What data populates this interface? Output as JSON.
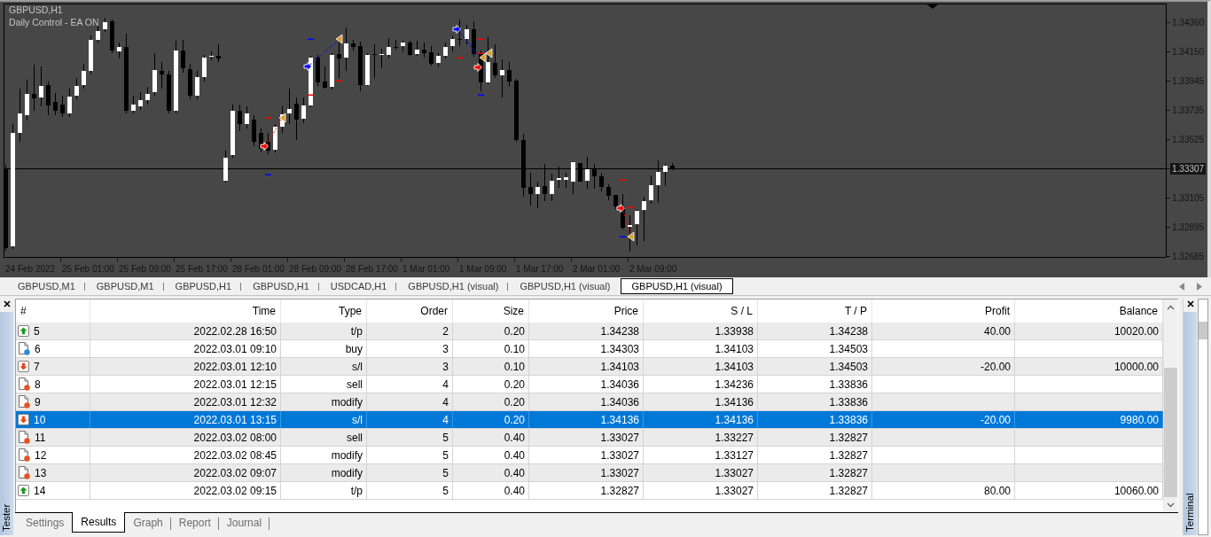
{
  "chart": {
    "symbol": "GBPUSD,H1",
    "caption": "Daily Control - EA ON",
    "price_labels": [
      {
        "label": "1.34360",
        "highlighted": false
      },
      {
        "label": "1.34150",
        "highlighted": false
      },
      {
        "label": "1.33945",
        "highlighted": false
      },
      {
        "label": "1.33735",
        "highlighted": false
      },
      {
        "label": "1.33525",
        "highlighted": false
      },
      {
        "label": "1.33307",
        "highlighted": true
      },
      {
        "label": "1.33105",
        "highlighted": false
      },
      {
        "label": "1.32895",
        "highlighted": false
      },
      {
        "label": "1.32685",
        "highlighted": false
      }
    ],
    "time_labels": [
      "24 Feb 2022",
      "25 Feb 01:00",
      "25 Feb 09:00",
      "25 Feb 17:00",
      "28 Feb 01:00",
      "28 Feb 09:00",
      "28 Feb 17:00",
      "1 Mar 01:00",
      "1 Mar 09:00",
      "1 Mar 17:00",
      "2 Mar 01:00",
      "2 Mar 09:00"
    ]
  },
  "chart_tabs": [
    {
      "label": "GBPUSD,M1",
      "selected": false
    },
    {
      "label": "GBPUSD,M1",
      "selected": false
    },
    {
      "label": "GBPUSD,H1",
      "selected": false
    },
    {
      "label": "GBPUSD,H1",
      "selected": false
    },
    {
      "label": "USDCAD,H1",
      "selected": false
    },
    {
      "label": "GBPUSD,H1 (visual)",
      "selected": false
    },
    {
      "label": "GBPUSD,H1 (visual)",
      "selected": false
    },
    {
      "label": "GBPUSD,H1 (visual)",
      "selected": true
    }
  ],
  "tester": {
    "side_label": "Tester",
    "columns": [
      "#",
      "Time",
      "Type",
      "Order",
      "Size",
      "Price",
      "S / L",
      "T / P",
      "Profit",
      "Balance"
    ],
    "rows": [
      {
        "kind": "tp",
        "selected": false,
        "cells": [
          "5",
          "2022.02.28 16:50",
          "t/p",
          "2",
          "0.20",
          "1.34238",
          "1.33938",
          "1.34238",
          "40.00",
          "10020.00"
        ]
      },
      {
        "kind": "buy",
        "selected": false,
        "cells": [
          "6",
          "2022.03.01 09:10",
          "buy",
          "3",
          "0.10",
          "1.34303",
          "1.34103",
          "1.34503"
        ]
      },
      {
        "kind": "sl",
        "selected": false,
        "cells": [
          "7",
          "2022.03.01 12:10",
          "s/l",
          "3",
          "0.10",
          "1.34103",
          "1.34103",
          "1.34503",
          "-20.00",
          "10000.00"
        ]
      },
      {
        "kind": "sell",
        "selected": false,
        "cells": [
          "8",
          "2022.03.01 12:15",
          "sell",
          "4",
          "0.20",
          "1.34036",
          "1.34236",
          "1.33836"
        ]
      },
      {
        "kind": "sell",
        "selected": false,
        "cells": [
          "9",
          "2022.03.01 12:32",
          "modify",
          "4",
          "0.20",
          "1.34036",
          "1.34136",
          "1.33836"
        ]
      },
      {
        "kind": "sl",
        "selected": true,
        "cells": [
          "10",
          "2022.03.01 13:15",
          "s/l",
          "4",
          "0.20",
          "1.34136",
          "1.34136",
          "1.33836",
          "-20.00",
          "9980.00"
        ]
      },
      {
        "kind": "sell",
        "selected": false,
        "cells": [
          "11",
          "2022.03.02 08:00",
          "sell",
          "5",
          "0.40",
          "1.33027",
          "1.33227",
          "1.32827"
        ]
      },
      {
        "kind": "sell",
        "selected": false,
        "cells": [
          "12",
          "2022.03.02 08:45",
          "modify",
          "5",
          "0.40",
          "1.33027",
          "1.33127",
          "1.32827"
        ]
      },
      {
        "kind": "sell",
        "selected": false,
        "cells": [
          "13",
          "2022.03.02 09:07",
          "modify",
          "5",
          "0.40",
          "1.33027",
          "1.33027",
          "1.32827"
        ]
      },
      {
        "kind": "tp",
        "selected": false,
        "cells": [
          "14",
          "2022.03.02 09:15",
          "t/p",
          "5",
          "0.40",
          "1.32827",
          "1.33027",
          "1.32827",
          "80.00",
          "10060.00"
        ]
      }
    ],
    "tabs": [
      {
        "label": "Settings",
        "selected": false
      },
      {
        "label": "Results",
        "selected": true
      },
      {
        "label": "Graph",
        "selected": false
      },
      {
        "label": "Report",
        "selected": false
      },
      {
        "label": "Journal",
        "selected": false
      }
    ]
  },
  "terminal": {
    "side_label": "Terminal"
  }
}
